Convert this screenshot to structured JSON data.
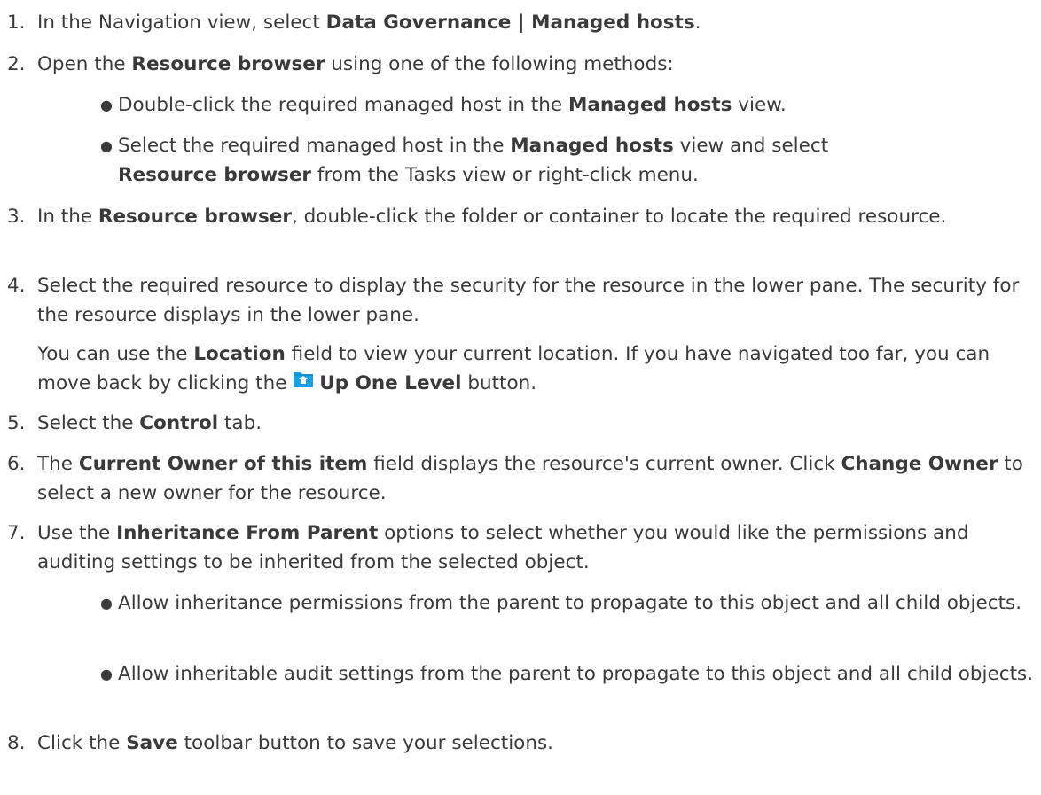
{
  "steps": [
    {
      "num": "1.",
      "parts": [
        {
          "t": "In the Navigation view, select "
        },
        {
          "b": "Data Governance | Managed hosts"
        },
        {
          "t": "."
        }
      ]
    },
    {
      "num": "2.",
      "parts": [
        {
          "t": "Open the "
        },
        {
          "b": "Resource browser"
        },
        {
          "t": " using one of the following methods:"
        }
      ],
      "bullets": [
        [
          {
            "t": "Double-click the required managed host in the "
          },
          {
            "b": "Managed hosts"
          },
          {
            "t": " view."
          }
        ],
        [
          {
            "t": "Select the required managed host in the "
          },
          {
            "b": "Managed hosts"
          },
          {
            "t": " view and select "
          },
          {
            "b": "Resource browser"
          },
          {
            "t": " from the Tasks view or right-click menu."
          }
        ]
      ]
    },
    {
      "num": "3.",
      "parts": [
        {
          "t": "In the "
        },
        {
          "b": "Resource browser"
        },
        {
          "t": ", double-click the folder or container to locate the required resource."
        }
      ]
    },
    {
      "num": "4.",
      "parts": [
        {
          "t": "Select the required resource to display the security for the resource in the lower pane. The security for the resource displays in the lower pane."
        }
      ],
      "note": [
        {
          "t": "You can use the "
        },
        {
          "b": "Location"
        },
        {
          "t": " field to view your current location. If you have navigated too far, you can move back by clicking the "
        },
        {
          "icon": "up-one-level-folder-icon"
        },
        {
          "b": "Up One Level"
        },
        {
          "t": " button."
        }
      ]
    },
    {
      "num": "5.",
      "parts": [
        {
          "t": "Select the "
        },
        {
          "b": "Control"
        },
        {
          "t": " tab."
        }
      ]
    },
    {
      "num": "6.",
      "parts": [
        {
          "t": "The "
        },
        {
          "b": "Current Owner of this item"
        },
        {
          "t": " field displays the resource's current owner. Click "
        },
        {
          "b": "Change Owner"
        },
        {
          "t": " to select a new owner for the resource."
        }
      ]
    },
    {
      "num": "7.",
      "parts": [
        {
          "t": "Use the "
        },
        {
          "b": "Inheritance From Parent"
        },
        {
          "t": " options to select whether you would like the permissions and auditing settings to be inherited from the selected object."
        }
      ],
      "bullets": [
        [
          {
            "t": "Allow inheritance permissions from the parent to propagate to this object and all child objects."
          }
        ],
        [
          {
            "t": "Allow inheritable audit settings from the parent to propagate to this object and all child objects."
          }
        ]
      ]
    },
    {
      "num": "8.",
      "parts": [
        {
          "t": "Click the "
        },
        {
          "b": "Save"
        },
        {
          "t": " toolbar button to save your selections."
        }
      ]
    }
  ],
  "colors": {
    "text": "#3a3a3a",
    "icon_folder": "#1a9fe0",
    "icon_arrow": "#ffffff"
  }
}
